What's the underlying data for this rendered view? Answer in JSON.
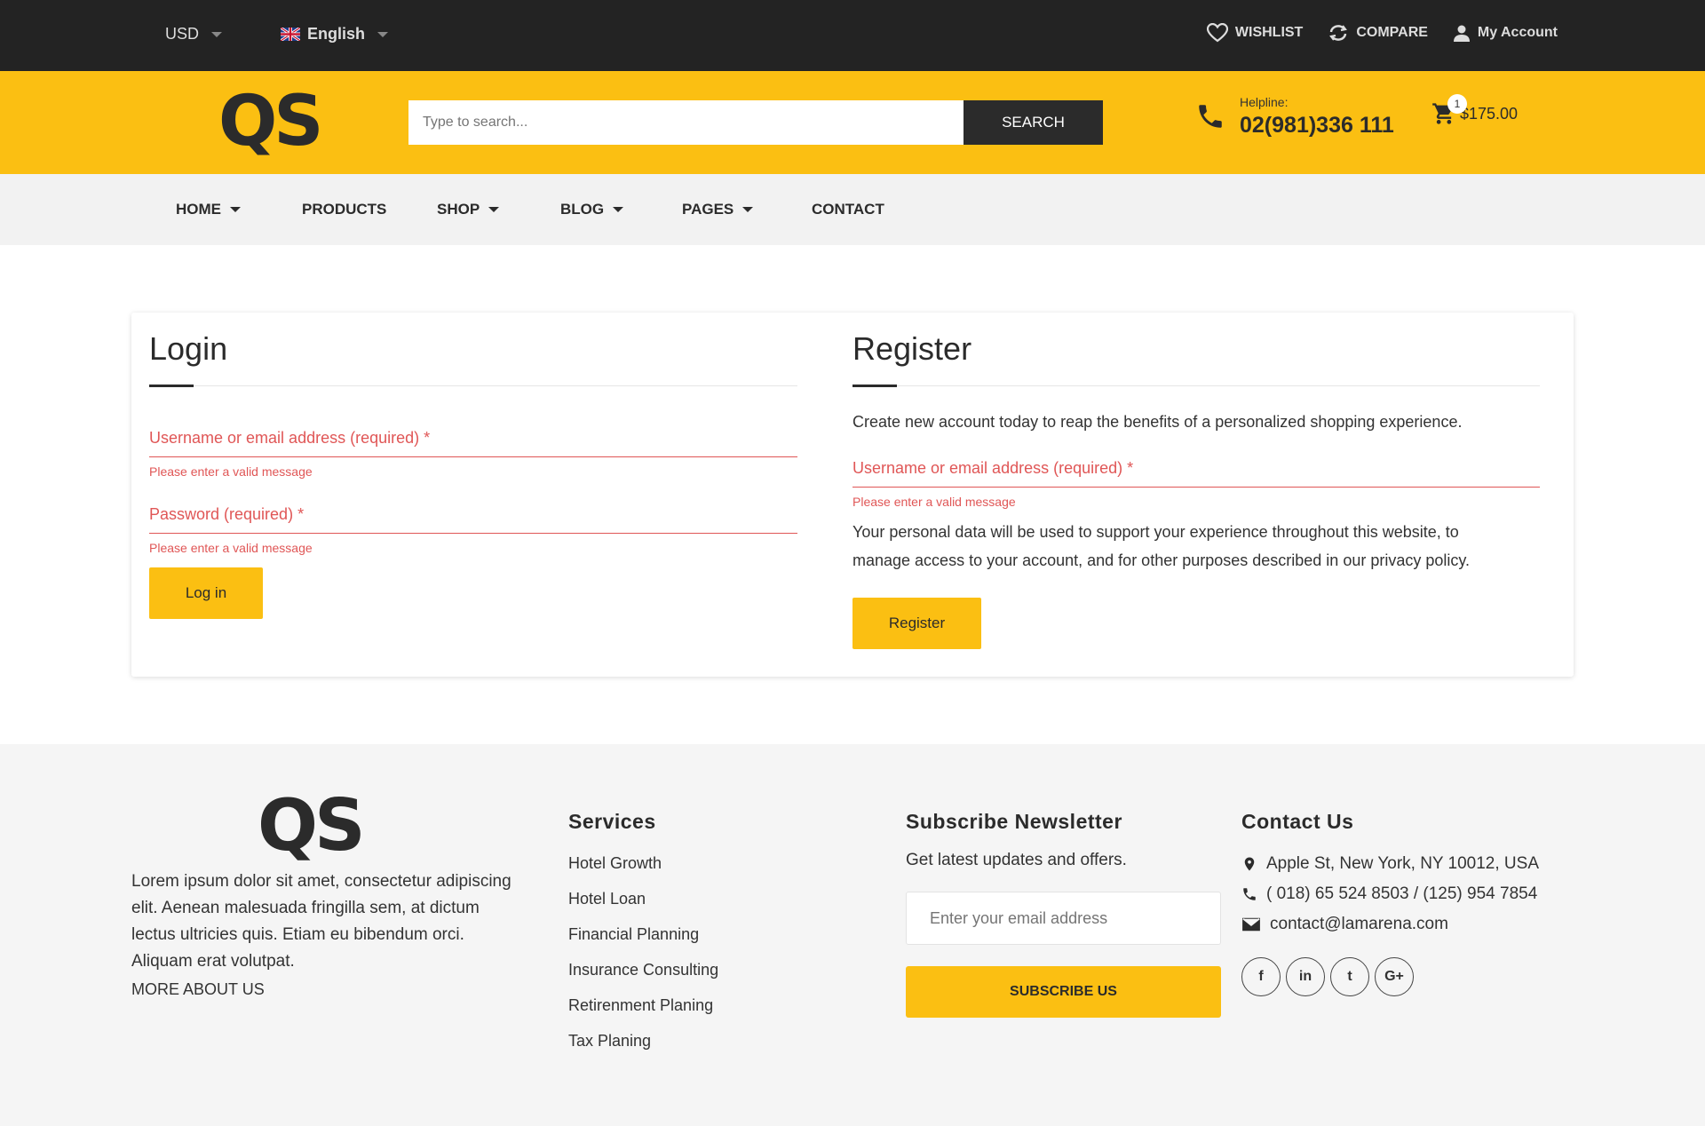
{
  "topbar": {
    "currency": "USD",
    "language": "English",
    "wishlist": "WISHLIST",
    "compare": "COMPARE",
    "account": "My Account"
  },
  "header": {
    "logo": "QS",
    "search_placeholder": "Type to search...",
    "search_button": "SEARCH",
    "helpline_label": "Helpline:",
    "helpline_number": "02(981)336 111",
    "cart_count": "1",
    "cart_total": "$175.00"
  },
  "nav": {
    "items": [
      {
        "label": "HOME"
      },
      {
        "label": "PRODUCTS"
      },
      {
        "label": "SHOP"
      },
      {
        "label": "BLOG"
      },
      {
        "label": "PAGES"
      },
      {
        "label": "CONTACT"
      }
    ]
  },
  "login": {
    "title": "Login",
    "username_label": "Username or email address (required) *",
    "username_error": "Please enter a valid message",
    "password_label": "Password (required) *",
    "password_error": "Please enter a valid message",
    "button": "Log in"
  },
  "register": {
    "title": "Register",
    "intro": "Create new account today to reap the benefits of a personalized shopping experience.",
    "username_label": "Username or email address (required) *",
    "username_error": "Please enter a valid message",
    "privacy_line1": "Your personal data will be used to support your experience throughout this website, to",
    "privacy_line2": "manage access to your account, and for other purposes described in our privacy policy.",
    "button": "Register"
  },
  "footer": {
    "logo": "QS",
    "about_line1": "Lorem ipsum dolor sit amet, consectetur adipiscing",
    "about_line2": "elit. Aenean malesuada fringilla sem, at dictum",
    "about_line3": "lectus ultricies quis. Etiam eu bibendum orci.",
    "about_line4": "Aliquam erat volutpat.",
    "more": "MORE ABOUT US",
    "services_title": "Services",
    "services": [
      "Hotel Growth",
      "Hotel Loan",
      "Financial Planning",
      "Insurance Consulting",
      "Retirenment Planing",
      "Tax Planing"
    ],
    "newsletter_title": "Subscribe Newsletter",
    "newsletter_sub": "Get latest updates and offers.",
    "newsletter_placeholder": "Enter your email address",
    "newsletter_button": "SUBSCRIBE US",
    "contact_title": "Contact Us",
    "address": "Apple St, New York, NY 10012, USA",
    "phone": "( 018) 65 524 8503 / (125) 954 7854",
    "email": "contact@lamarena.com",
    "social": [
      "f",
      "in",
      "t",
      "G+"
    ]
  },
  "colors": {
    "accent": "#fbbf12",
    "dark": "#232323",
    "error": "#e05656"
  }
}
